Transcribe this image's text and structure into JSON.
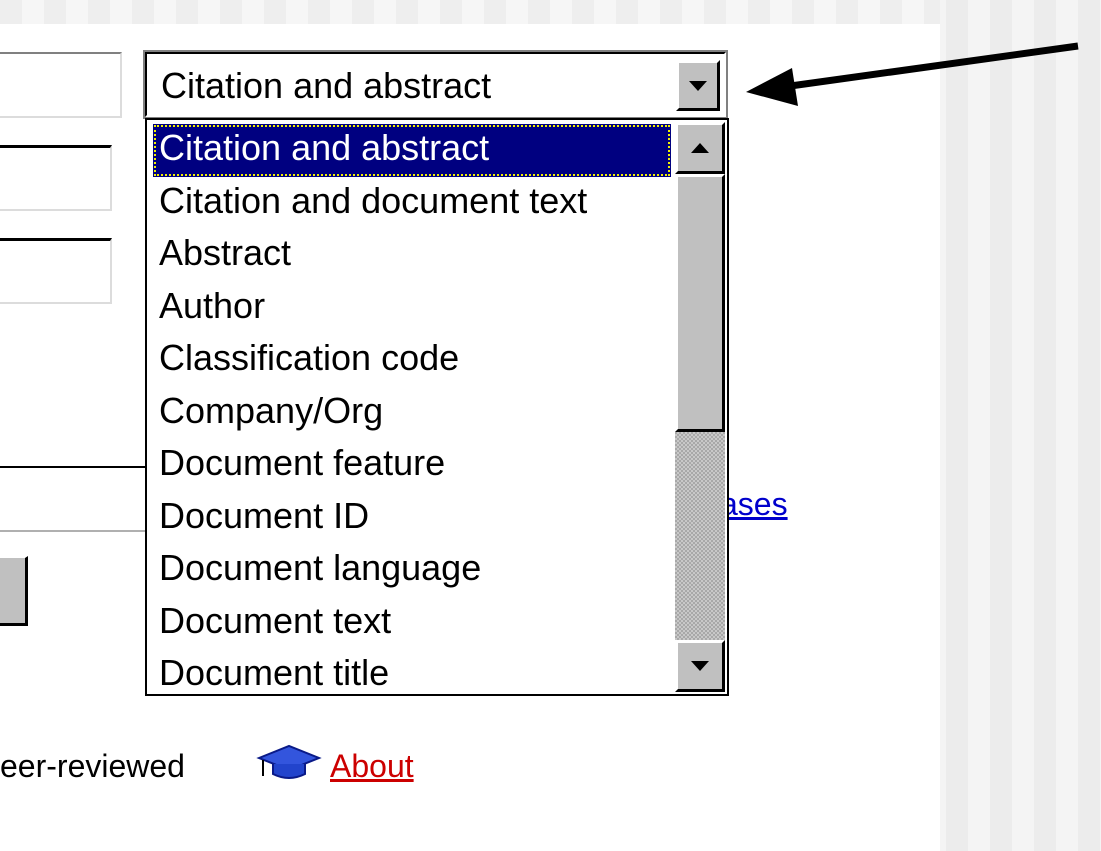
{
  "select": {
    "value": "Citation and abstract"
  },
  "listbox": {
    "options": [
      "Citation and abstract",
      "Citation and document text",
      "Abstract",
      "Author",
      "Classification code",
      "Company/Org",
      "Document feature",
      "Document ID",
      "Document language",
      "Document text",
      "Document title"
    ],
    "selected_index": 0
  },
  "links": {
    "databases_partial": "ases",
    "about": "About"
  },
  "peer_text": "eer-reviewed",
  "colors": {
    "highlight": "#000080",
    "link": "#0000cc",
    "about_link": "#cc0000",
    "face": "#c0c0c0",
    "cap_icon": "#2244cc"
  },
  "icons": {
    "cap": "graduation-cap-icon",
    "dropdown": "chevron-down-icon",
    "scroll_up": "scroll-up-icon",
    "scroll_down": "scroll-down-icon",
    "pointer": "arrow-icon"
  }
}
